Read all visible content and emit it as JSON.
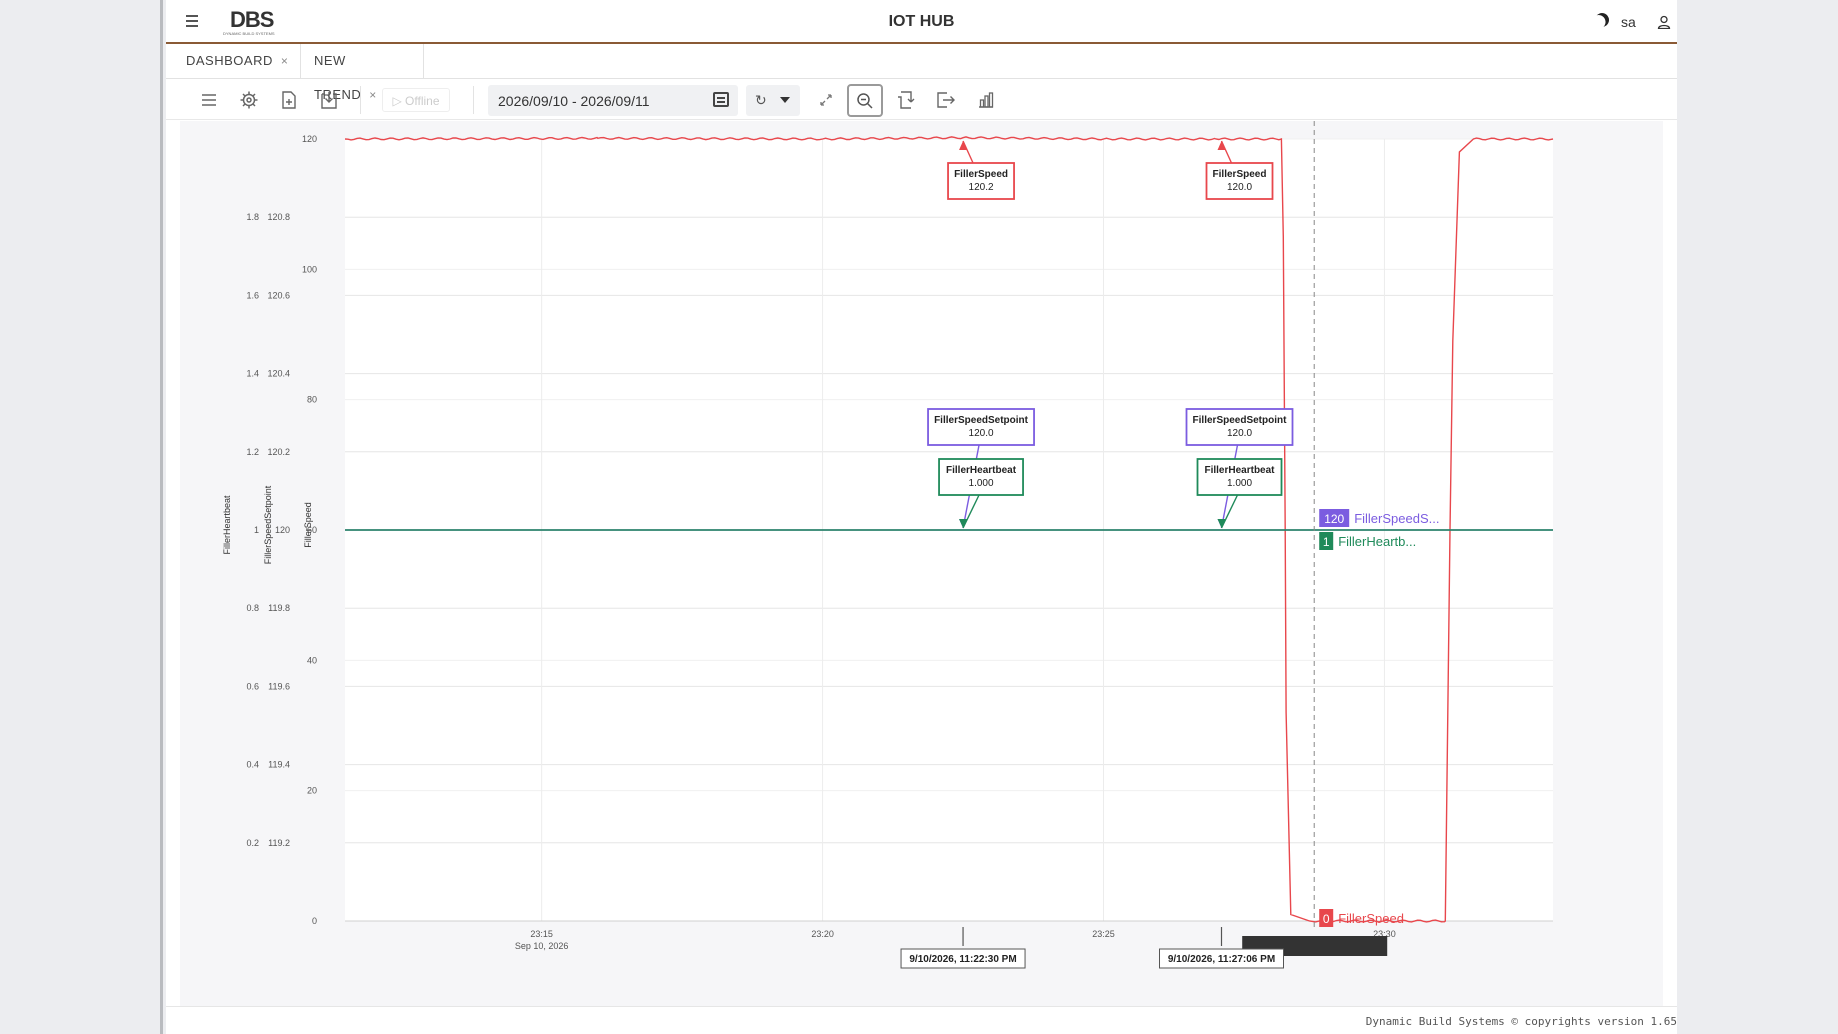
{
  "header": {
    "logo_text": "DBS",
    "logo_subtext": "DYNAMIC BUILD SYSTEMS",
    "title": "IOT HUB",
    "user": "sa"
  },
  "tabs": [
    {
      "label": "DASHBOARD",
      "close": "×"
    },
    {
      "label": "NEW TREND",
      "close": "×"
    }
  ],
  "toolbar": {
    "offline_label": "Offline",
    "date_range": "2026/09/10 - 2026/09/11"
  },
  "footer": {
    "text": "Dynamic Build Systems © copyrights version 1.65"
  },
  "chart_data": {
    "type": "line",
    "x_range": [
      "2026-09-10T23:11:30",
      "2026-09-10T23:33:00"
    ],
    "x_ticks": [
      {
        "time": "2026-09-10T23:15:00",
        "label": "23:15",
        "sublabel": "Sep 10, 2026"
      },
      {
        "time": "2026-09-10T23:20:00",
        "label": "23:20"
      },
      {
        "time": "2026-09-10T23:25:00",
        "label": "23:25"
      },
      {
        "time": "2026-09-10T23:30:00",
        "label": "23:30"
      }
    ],
    "axes": [
      {
        "name": "FillerHeartbeat",
        "ylim": [
          0,
          2
        ],
        "ticks": [
          0.2,
          0.4,
          0.6,
          0.8,
          1,
          1.2,
          1.4,
          1.6,
          1.8
        ],
        "tick_labels": [
          "0.2",
          "0.4",
          "0.6",
          "0.8",
          "1",
          "1.2",
          "1.4",
          "1.6",
          "1.8"
        ]
      },
      {
        "name": "FillerSpeedSetpoint",
        "ylim": [
          119,
          121
        ],
        "ticks": [
          119.2,
          119.4,
          119.6,
          119.8,
          120,
          120.2,
          120.4,
          120.6,
          120.8
        ],
        "tick_labels": [
          "119.2",
          "119.4",
          "119.6",
          "119.8",
          "120",
          "120.2",
          "120.4",
          "120.6",
          "120.8"
        ]
      },
      {
        "name": "FillerSpeed",
        "ylim": [
          0,
          120
        ],
        "ticks": [
          0,
          20,
          40,
          60,
          80,
          100,
          120
        ],
        "tick_labels": [
          "0",
          "20",
          "40",
          "60",
          "80",
          "100",
          "120"
        ]
      }
    ],
    "series": [
      {
        "name": "FillerSpeed",
        "color": "#e8474c",
        "points": [
          [
            "2026-09-10T23:11:30",
            120.0
          ],
          [
            "2026-09-10T23:16:00",
            120.1
          ],
          [
            "2026-09-10T23:20:00",
            120.0
          ],
          [
            "2026-09-10T23:22:30",
            120.2
          ],
          [
            "2026-09-10T23:25:00",
            120.0
          ],
          [
            "2026-09-10T23:27:00",
            120.0
          ],
          [
            "2026-09-10T23:28:10",
            120.0
          ],
          [
            "2026-09-10T23:28:12",
            105.0
          ],
          [
            "2026-09-10T23:28:14",
            60.0
          ],
          [
            "2026-09-10T23:28:15",
            32.0
          ],
          [
            "2026-09-10T23:28:20",
            1.0
          ],
          [
            "2026-09-10T23:28:40",
            0.0
          ],
          [
            "2026-09-10T23:31:05",
            0.0
          ],
          [
            "2026-09-10T23:31:10",
            60.0
          ],
          [
            "2026-09-10T23:31:13",
            89.0
          ],
          [
            "2026-09-10T23:31:20",
            118.0
          ],
          [
            "2026-09-10T23:31:35",
            120.0
          ],
          [
            "2026-09-10T23:33:00",
            120.0
          ]
        ]
      },
      {
        "name": "FillerSpeedSetpoint",
        "color": "#7b5ce0",
        "points": [
          [
            "2026-09-10T23:11:30",
            120.0
          ],
          [
            "2026-09-10T23:33:00",
            120.0
          ]
        ]
      },
      {
        "name": "FillerHeartbeat",
        "color": "#1f8a5a",
        "points": [
          [
            "2026-09-10T23:11:30",
            1.0
          ],
          [
            "2026-09-10T23:33:00",
            1.0
          ]
        ]
      }
    ],
    "cursor_time": "2026-09-10T23:28:45",
    "cursor_values": [
      {
        "series": "FillerSpeedSetpoint",
        "value": "120",
        "label": "FillerSpeedS...",
        "color": "#7b5ce0"
      },
      {
        "series": "FillerHeartbeat",
        "value": "1",
        "label": "FillerHeartb...",
        "color": "#1f8a5a"
      },
      {
        "series": "FillerSpeed",
        "value": "0",
        "label": "FillerSpeed",
        "color": "#e8474c"
      }
    ],
    "markers": [
      {
        "time": "2026-09-10T23:22:30",
        "label": "9/10/2026, 11:22:30 PM",
        "tooltips": [
          {
            "series": "FillerSpeed",
            "name": "FillerSpeed",
            "value": "120.2",
            "color": "#e8474c"
          },
          {
            "series": "FillerSpeedSetpoint",
            "name": "FillerSpeedSetpoint",
            "value": "120.0",
            "color": "#7b5ce0"
          },
          {
            "series": "FillerHeartbeat",
            "name": "FillerHeartbeat",
            "value": "1.000",
            "color": "#1f8a5a"
          }
        ]
      },
      {
        "time": "2026-09-10T23:27:06",
        "label": "9/10/2026, 11:27:06 PM",
        "tooltips": [
          {
            "series": "FillerSpeed",
            "name": "FillerSpeed",
            "value": "120.0",
            "color": "#e8474c"
          },
          {
            "series": "FillerSpeedSetpoint",
            "name": "FillerSpeedSetpoint",
            "value": "120.0",
            "color": "#7b5ce0"
          },
          {
            "series": "FillerHeartbeat",
            "name": "FillerHeartbeat",
            "value": "1.000",
            "color": "#1f8a5a"
          }
        ]
      }
    ],
    "grid": true,
    "legend": "none"
  }
}
